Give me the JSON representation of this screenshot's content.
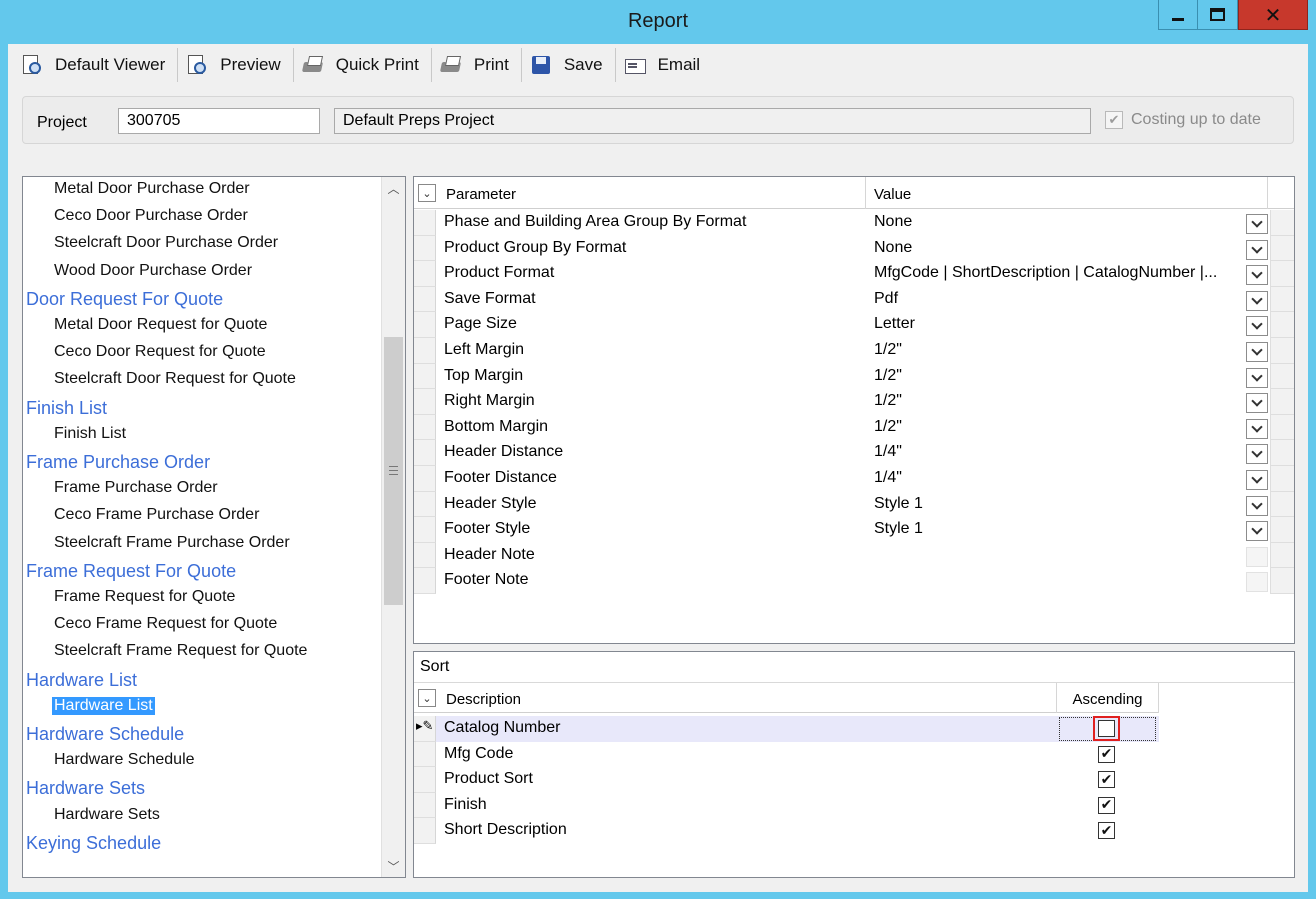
{
  "window": {
    "title": "Report"
  },
  "toolbar": {
    "default_viewer": "Default Viewer",
    "preview": "Preview",
    "quick_print": "Quick Print",
    "print": "Print",
    "save": "Save",
    "email": "Email"
  },
  "project": {
    "label": "Project",
    "number": "300705",
    "name": "Default Preps Project",
    "costing_label": "Costing up to date",
    "costing_checked": true
  },
  "tree": {
    "items": [
      {
        "type": "leaf",
        "label": "Metal Door Purchase Order"
      },
      {
        "type": "leaf",
        "label": "Ceco Door Purchase Order"
      },
      {
        "type": "leaf",
        "label": "Steelcraft Door Purchase Order"
      },
      {
        "type": "leaf",
        "label": "Wood Door Purchase Order"
      },
      {
        "type": "group",
        "label": "Door Request For Quote"
      },
      {
        "type": "leaf",
        "label": "Metal Door Request for Quote"
      },
      {
        "type": "leaf",
        "label": "Ceco Door Request for Quote"
      },
      {
        "type": "leaf",
        "label": "Steelcraft Door Request for Quote"
      },
      {
        "type": "group",
        "label": "Finish List"
      },
      {
        "type": "leaf",
        "label": "Finish List"
      },
      {
        "type": "group",
        "label": "Frame Purchase Order"
      },
      {
        "type": "leaf",
        "label": "Frame Purchase Order"
      },
      {
        "type": "leaf",
        "label": "Ceco Frame Purchase Order"
      },
      {
        "type": "leaf",
        "label": "Steelcraft Frame Purchase Order"
      },
      {
        "type": "group",
        "label": "Frame Request For Quote"
      },
      {
        "type": "leaf",
        "label": "Frame Request for Quote"
      },
      {
        "type": "leaf",
        "label": "Ceco Frame Request for Quote"
      },
      {
        "type": "leaf",
        "label": "Steelcraft Frame Request for Quote"
      },
      {
        "type": "group",
        "label": "Hardware List"
      },
      {
        "type": "leaf",
        "label": "Hardware List",
        "selected": true
      },
      {
        "type": "group",
        "label": "Hardware Schedule"
      },
      {
        "type": "leaf",
        "label": "Hardware Schedule"
      },
      {
        "type": "group",
        "label": "Hardware Sets"
      },
      {
        "type": "leaf",
        "label": "Hardware Sets"
      },
      {
        "type": "group",
        "label": "Keying Schedule"
      }
    ]
  },
  "parameters": {
    "header_parameter": "Parameter",
    "header_value": "Value",
    "rows": [
      {
        "name": "Phase and Building Area Group By Format",
        "value": "None",
        "dropdown": true
      },
      {
        "name": "Product Group By Format",
        "value": "None",
        "dropdown": true
      },
      {
        "name": "Product Format",
        "value": "MfgCode | ShortDescription | CatalogNumber |...",
        "dropdown": true
      },
      {
        "name": "Save Format",
        "value": "Pdf",
        "dropdown": true
      },
      {
        "name": "Page Size",
        "value": "Letter",
        "dropdown": true
      },
      {
        "name": "Left Margin",
        "value": "1/2\"",
        "dropdown": true
      },
      {
        "name": "Top Margin",
        "value": "1/2\"",
        "dropdown": true
      },
      {
        "name": "Right Margin",
        "value": "1/2\"",
        "dropdown": true
      },
      {
        "name": "Bottom Margin",
        "value": "1/2\"",
        "dropdown": true
      },
      {
        "name": "Header Distance",
        "value": "1/4\"",
        "dropdown": true
      },
      {
        "name": "Footer Distance",
        "value": "1/4\"",
        "dropdown": true
      },
      {
        "name": "Header Style",
        "value": "Style 1",
        "dropdown": true
      },
      {
        "name": "Footer Style",
        "value": "Style 1",
        "dropdown": true
      },
      {
        "name": "Header Note",
        "value": "",
        "dropdown": false
      },
      {
        "name": "Footer Note",
        "value": "",
        "dropdown": false
      }
    ]
  },
  "sort": {
    "title": "Sort",
    "header_description": "Description",
    "header_ascending": "Ascending",
    "rows": [
      {
        "description": "Catalog Number",
        "ascending": false,
        "editing": true
      },
      {
        "description": "Mfg Code",
        "ascending": true
      },
      {
        "description": "Product Sort",
        "ascending": true
      },
      {
        "description": "Finish",
        "ascending": true
      },
      {
        "description": "Short Description",
        "ascending": true
      }
    ]
  },
  "colors": {
    "window_frame": "#63c8ec",
    "tree_group": "#3c6ed8",
    "selection": "#3399ff",
    "highlight": "#e02020",
    "close_button": "#c7382c"
  }
}
